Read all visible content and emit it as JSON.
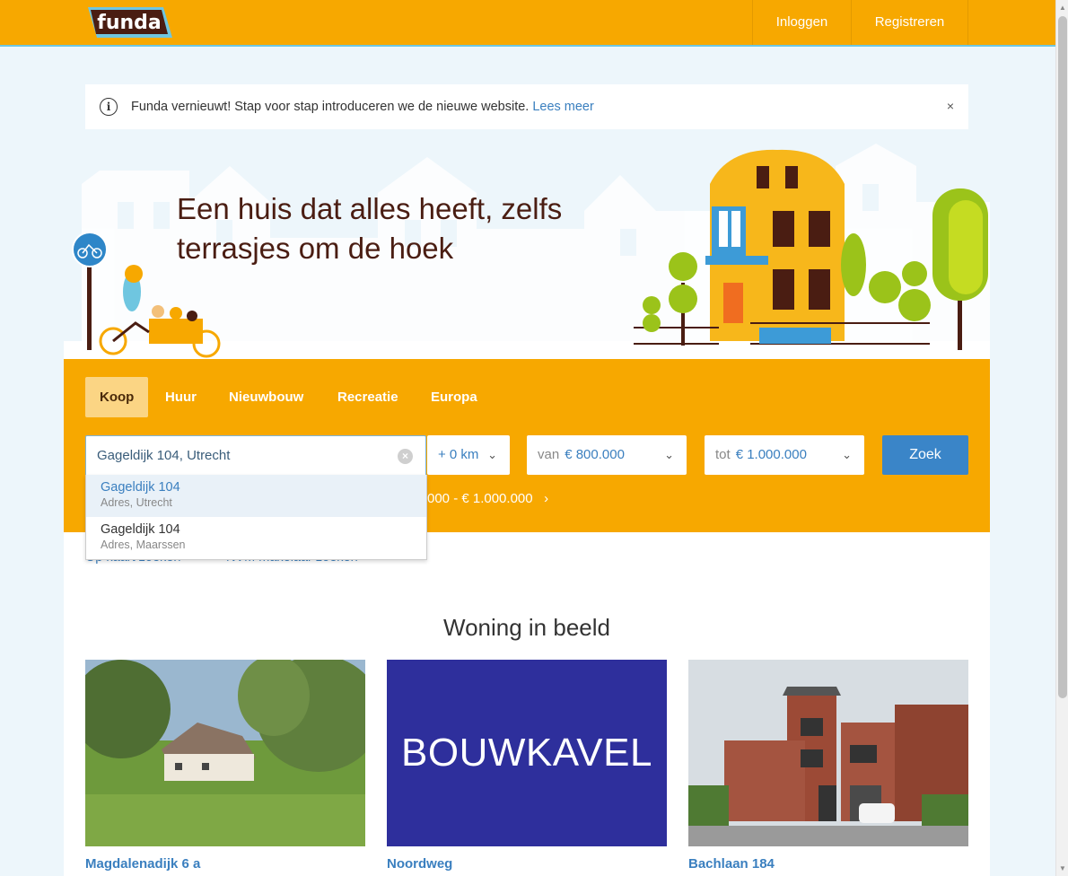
{
  "header": {
    "logo_text": "funda",
    "login_label": "Inloggen",
    "register_label": "Registreren"
  },
  "notice": {
    "text": "Funda vernieuwt! Stap voor stap introduceren we de nieuwe website.",
    "link_label": "Lees meer",
    "close_symbol": "×"
  },
  "hero": {
    "title": "Een huis dat alles heeft, zelfs terrasjes om de hoek"
  },
  "search": {
    "tabs": [
      {
        "label": "Koop",
        "active": true
      },
      {
        "label": "Huur",
        "active": false
      },
      {
        "label": "Nieuwbouw",
        "active": false
      },
      {
        "label": "Recreatie",
        "active": false
      },
      {
        "label": "Europa",
        "active": false
      }
    ],
    "location_value": "Gageldijk 104, Utrecht",
    "radius_value": "+ 0 km",
    "price_from_prefix": "van",
    "price_from_value": "€ 800.000",
    "price_to_prefix": "tot",
    "price_to_value": "€ 1.000.000",
    "submit_label": "Zoek",
    "recent_search_text": "000 - € 1.000.000"
  },
  "suggestions": [
    {
      "main": "Gageldijk 104",
      "sub": "Adres, Utrecht",
      "highlighted": true
    },
    {
      "main": "Gageldijk 104",
      "sub": "Adres, Maarssen",
      "highlighted": false
    }
  ],
  "links": {
    "map_search": "Op kaart zoeken",
    "nvm_search": "NVM makelaar zoeken"
  },
  "featured": {
    "title": "Woning in beeld",
    "cards": [
      {
        "caption": "Magdalenadijk 6 a"
      },
      {
        "caption": "Noordweg",
        "image_text": "BOUWKAVEL"
      },
      {
        "caption": "Bachlaan 184"
      }
    ]
  },
  "colors": {
    "brand_orange": "#f7a800",
    "link_blue": "#3a7fbf",
    "button_blue": "#3a85c8",
    "hero_text": "#4a1d12"
  }
}
